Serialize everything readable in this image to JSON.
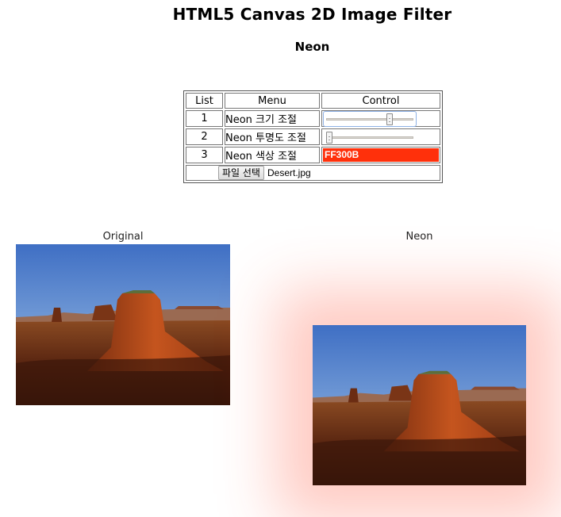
{
  "page": {
    "title": "HTML5 Canvas 2D Image Filter",
    "subtitle": "Neon"
  },
  "table": {
    "headers": [
      "List",
      "Menu",
      "Control"
    ],
    "rows": [
      {
        "num": "1",
        "menu": "Neon 크기 조절",
        "control": "slider",
        "value": 0.76
      },
      {
        "num": "2",
        "menu": "Neon 투명도 조절",
        "control": "slider",
        "value": 0.0
      },
      {
        "num": "3",
        "menu": "Neon 색상 조절",
        "control": "color",
        "value": "FF300B"
      }
    ],
    "file": {
      "button_label": "파일 선택",
      "file_name": "Desert.jpg"
    }
  },
  "images": {
    "original_label": "Original",
    "filtered_label": "Neon"
  },
  "colors": {
    "neon": "#FF300B"
  }
}
